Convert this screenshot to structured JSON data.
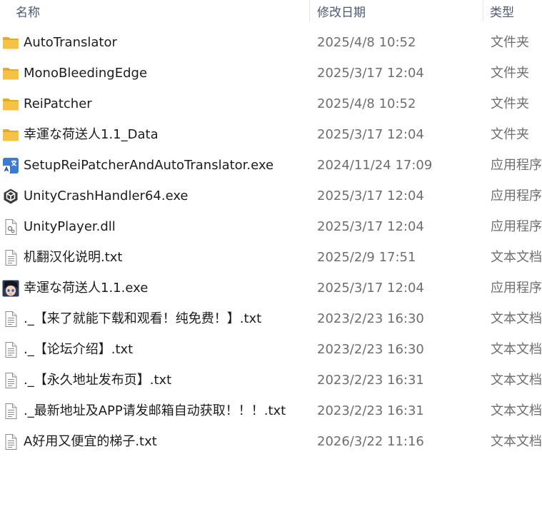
{
  "header": {
    "name": "名称",
    "date": "修改日期",
    "type": "类型"
  },
  "files": [
    {
      "name": "AutoTranslator",
      "date": "2025/4/8 10:52",
      "type": "文件夹",
      "icon": "folder-icon"
    },
    {
      "name": "MonoBleedingEdge",
      "date": "2025/3/17 12:04",
      "type": "文件夹",
      "icon": "folder-icon"
    },
    {
      "name": "ReiPatcher",
      "date": "2025/4/8 10:52",
      "type": "文件夹",
      "icon": "folder-icon"
    },
    {
      "name": "幸運な荷送人1.1_Data",
      "date": "2025/3/17 12:04",
      "type": "文件夹",
      "icon": "folder-icon"
    },
    {
      "name": "SetupReiPatcherAndAutoTranslator.exe",
      "date": "2024/11/24 17:09",
      "type": "应用程序",
      "icon": "translator-app-icon"
    },
    {
      "name": "UnityCrashHandler64.exe",
      "date": "2025/3/17 12:04",
      "type": "应用程序",
      "icon": "unity-icon"
    },
    {
      "name": "UnityPlayer.dll",
      "date": "2025/3/17 12:04",
      "type": "应用程序",
      "icon": "dll-file-icon"
    },
    {
      "name": "机翻汉化说明.txt",
      "date": "2025/2/9 17:51",
      "type": "文本文档",
      "icon": "text-file-icon"
    },
    {
      "name": "幸運な荷送人1.1.exe",
      "date": "2025/3/17 12:04",
      "type": "应用程序",
      "icon": "game-app-icon"
    },
    {
      "name": "._【来了就能下载和观看！纯免费！】.txt",
      "date": "2023/2/23 16:30",
      "type": "文本文档",
      "icon": "text-file-icon"
    },
    {
      "name": "._【论坛介绍】.txt",
      "date": "2023/2/23 16:30",
      "type": "文本文档",
      "icon": "text-file-icon"
    },
    {
      "name": "._【永久地址发布页】.txt",
      "date": "2023/2/23 16:31",
      "type": "文本文档",
      "icon": "text-file-icon"
    },
    {
      "name": "._最新地址及APP请发邮箱自动获取！！！.txt",
      "date": "2023/2/23 16:31",
      "type": "文本文档",
      "icon": "text-file-icon"
    },
    {
      "name": "A好用又便宜的梯子.txt",
      "date": "2026/3/22 11:16",
      "type": "文本文档",
      "icon": "text-file-icon"
    }
  ],
  "colors": {
    "folder": "#F5C243",
    "folder_dark": "#E4A927",
    "header_text": "#4A5A75",
    "secondary_text": "#6E6E6E"
  }
}
